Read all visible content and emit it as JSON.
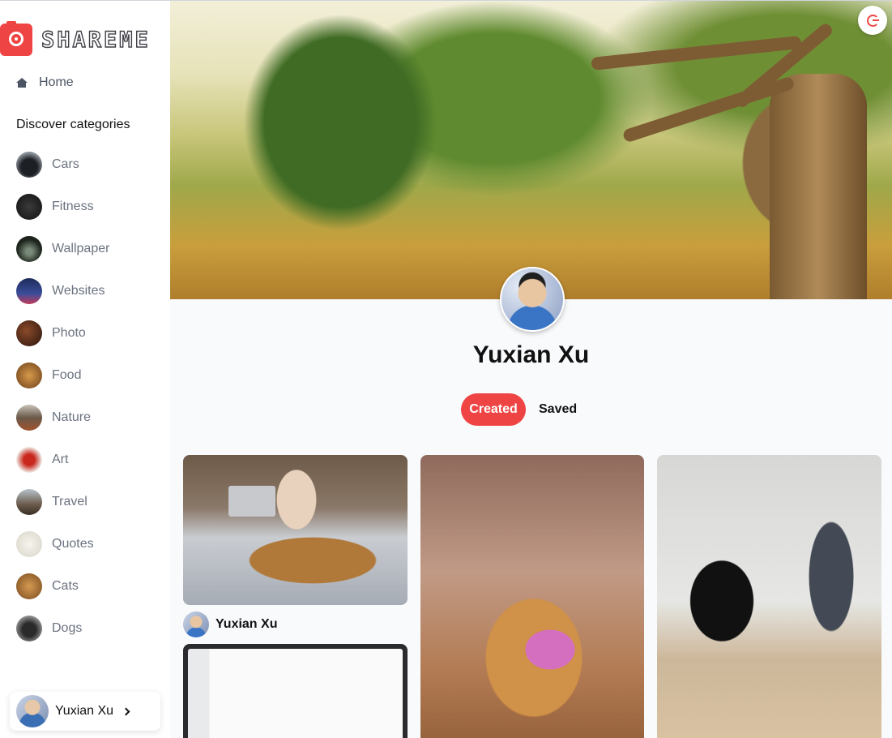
{
  "app": {
    "logo_text": "SHAREME"
  },
  "sidebar": {
    "home_label": "Home",
    "discover_title": "Discover categories",
    "categories": [
      {
        "label": "Cars",
        "thumb_color": "#4a4f57"
      },
      {
        "label": "Fitness",
        "thumb_color": "#2a2a2a"
      },
      {
        "label": "Wallpaper",
        "thumb_color": "#3d4a3d"
      },
      {
        "label": "Websites",
        "thumb_color": "#2b3a6b"
      },
      {
        "label": "Photo",
        "thumb_color": "#4a2a1f"
      },
      {
        "label": "Food",
        "thumb_color": "#9a6a3a"
      },
      {
        "label": "Nature",
        "thumb_color": "#5a4a3a"
      },
      {
        "label": "Art",
        "thumb_color": "#d65a4a"
      },
      {
        "label": "Travel",
        "thumb_color": "#6a5a4a"
      },
      {
        "label": "Quotes",
        "thumb_color": "#e8e6df"
      },
      {
        "label": "Cats",
        "thumb_color": "#b07a3a"
      },
      {
        "label": "Dogs",
        "thumb_color": "#5a5a5a"
      }
    ],
    "user_name": "Yuxian Xu"
  },
  "profile": {
    "name": "Yuxian Xu",
    "tabs": [
      "Created",
      "Saved"
    ],
    "active_tab": "Created"
  },
  "pins": [
    {
      "owner_name": "Yuxian Xu"
    }
  ],
  "colors": {
    "accent": "#ef4444"
  }
}
